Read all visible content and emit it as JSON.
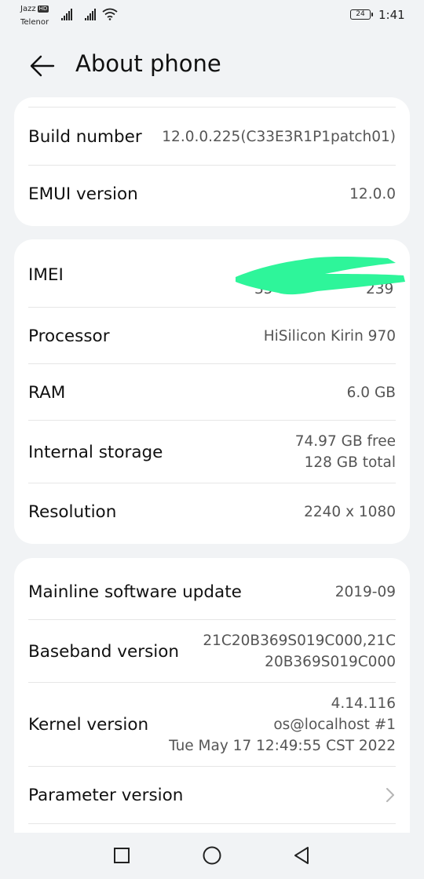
{
  "status_bar": {
    "carrier_primary": "Jazz",
    "carrier_primary_badge": "HD",
    "carrier_secondary": "Telenor",
    "battery_level": "24",
    "time": "1:41"
  },
  "header": {
    "title": "About phone",
    "back_icon": "arrow-left-icon"
  },
  "card1": {
    "rows": [
      {
        "label": "Build number",
        "value": "12.0.0.225(C33E3R1P1patch01)"
      },
      {
        "label": "EMUI version",
        "value": "12.0.0"
      }
    ]
  },
  "card2": {
    "rows": [
      {
        "label": "IMEI",
        "value_start": "35",
        "value_end": "239"
      },
      {
        "label": "Processor",
        "value": "HiSilicon Kirin 970"
      },
      {
        "label": "RAM",
        "value": "6.0 GB"
      },
      {
        "label": "Internal storage",
        "value_line1": "74.97  GB free",
        "value_line2": "128  GB total"
      },
      {
        "label": "Resolution",
        "value": "2240 x 1080"
      }
    ],
    "redaction_color": "#2ef59a"
  },
  "card3": {
    "rows": [
      {
        "label": "Mainline software update",
        "value": "2019-09"
      },
      {
        "label": "Baseband version",
        "value_line1": "21C20B369S019C000,21C",
        "value_line2": "20B369S019C000"
      },
      {
        "label": "Kernel version",
        "value_line1": "4.14.116",
        "value_line2": "os@localhost #1",
        "value_line3": "Tue May 17 12:49:55 CST 2022"
      },
      {
        "label": "Parameter version",
        "chevron_icon": "chevron-right-icon"
      }
    ]
  },
  "nav_bar": {
    "recents_icon": "square-icon",
    "home_icon": "circle-icon",
    "back_icon": "triangle-back-icon"
  }
}
